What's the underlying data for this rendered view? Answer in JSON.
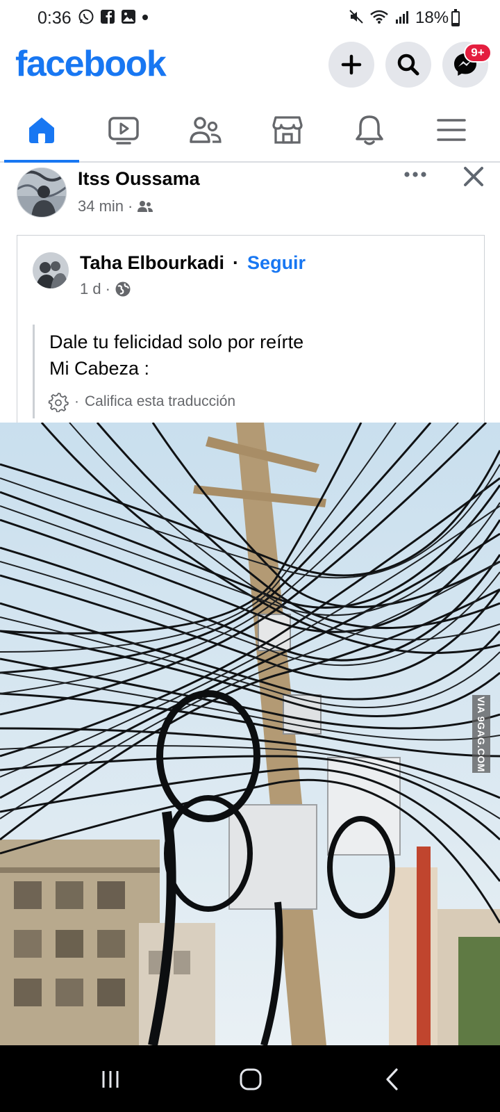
{
  "status_bar": {
    "time": "0:36",
    "battery_text": "18%",
    "battery_level": 0.18,
    "left_icons": [
      "whatsapp-icon",
      "facebook-icon",
      "gallery-icon",
      "dot-icon"
    ],
    "right_icons": [
      "mute-icon",
      "wifi-icon",
      "signal-icon"
    ]
  },
  "header": {
    "brand": "facebook",
    "messenger_badge": "9+",
    "buttons": [
      "plus-icon",
      "search-icon",
      "messenger-icon"
    ]
  },
  "tabs": [
    {
      "name": "home",
      "icon": "home-icon",
      "active": true
    },
    {
      "name": "watch",
      "icon": "video-icon",
      "active": false
    },
    {
      "name": "friends",
      "icon": "friends-icon",
      "active": false
    },
    {
      "name": "marketplace",
      "icon": "store-icon",
      "active": false
    },
    {
      "name": "notifications",
      "icon": "bell-icon",
      "active": false
    },
    {
      "name": "menu",
      "icon": "hamburger-icon",
      "active": false
    }
  ],
  "post": {
    "author": "Itss Oussama",
    "time": "34 min",
    "audience_icon": "friends-icon",
    "shared": {
      "author": "Taha Elbourkadi",
      "follow_label": "Seguir",
      "time": "1 d",
      "audience_icon": "globe-icon",
      "text_line1": "Dale tu felicidad solo por reírte",
      "text_line2": "Mi Cabeza :",
      "rate_translation": "Califica esta traducción"
    },
    "photo_watermark": "VIA 9GAG.COM"
  },
  "colors": {
    "brand": "#1877f2",
    "badge": "#e41e3f",
    "secondary_text": "#65676b",
    "nav_bar": "#000000"
  }
}
